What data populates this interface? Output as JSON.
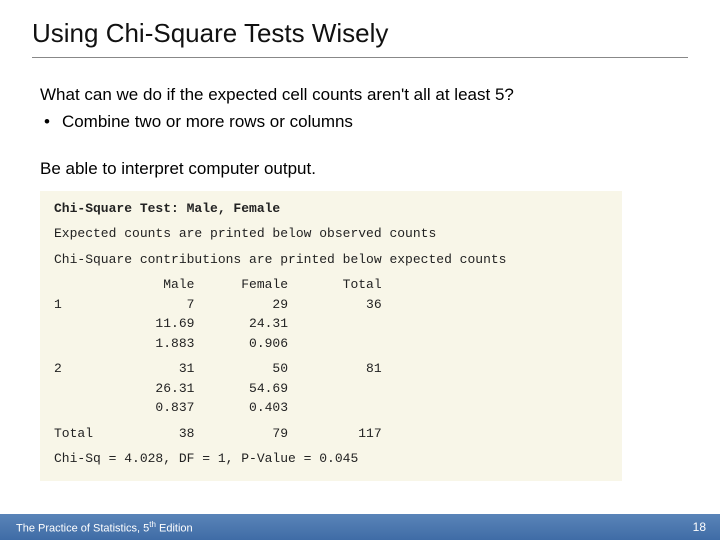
{
  "title": "Using Chi-Square Tests Wisely",
  "question": "What can we do if the expected cell counts aren't all at least 5?",
  "bullet1": "Combine two or more rows or columns",
  "interpret": "Be able to interpret computer output.",
  "output": {
    "heading": "Chi-Square Test: Male, Female",
    "note1": "Expected counts are printed below observed counts",
    "note2": "Chi-Square contributions are printed below expected counts",
    "hdr": "              Male      Female       Total",
    "r1a": "1                7          29          36",
    "r1b": "             11.69       24.31",
    "r1c": "             1.883       0.906",
    "r2a": "2               31          50          81",
    "r2b": "             26.31       54.69",
    "r2c": "             0.837       0.403",
    "tot": "Total           38          79         117",
    "chi": "Chi-Sq = 4.028, DF = 1, P-Value = 0.045"
  },
  "footer_book_a": "The Practice of Statistics, 5",
  "footer_book_b": " Edition",
  "page_number": "18"
}
